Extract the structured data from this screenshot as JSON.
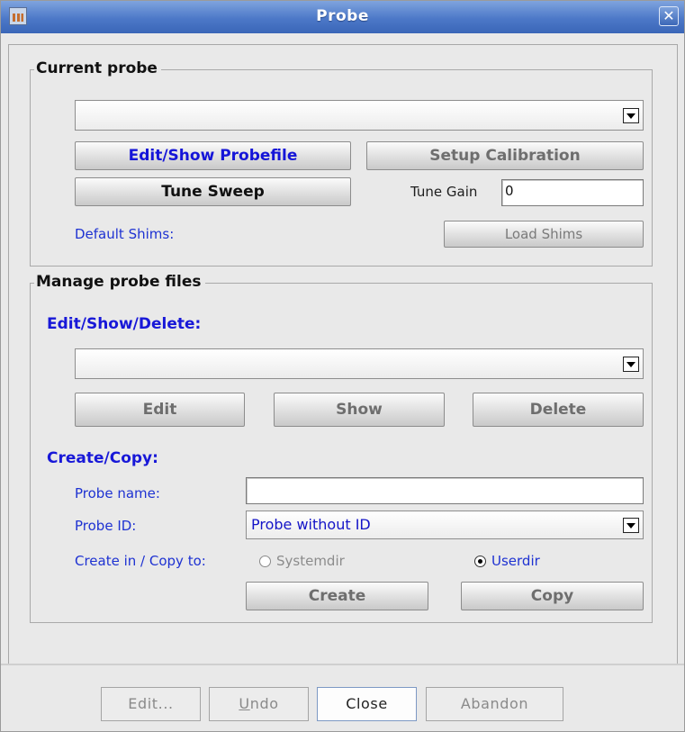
{
  "window": {
    "title": "Probe"
  },
  "current_probe": {
    "group_label": "Current probe",
    "probe_select_value": "",
    "edit_show_probefile": "Edit/Show Probefile",
    "setup_calibration": "Setup Calibration",
    "tune_sweep": "Tune Sweep",
    "tune_gain_label": "Tune Gain",
    "tune_gain_value": "0",
    "default_shims_label": "Default Shims:",
    "load_shims": "Load Shims"
  },
  "manage": {
    "group_label": "Manage probe files",
    "eds_heading": "Edit/Show/Delete:",
    "file_select_value": "",
    "edit": "Edit",
    "show": "Show",
    "delete": "Delete",
    "create_copy_heading": "Create/Copy:",
    "probe_name_label": "Probe name:",
    "probe_name_value": "",
    "probe_id_label": "Probe ID:",
    "probe_id_value": "Probe without ID",
    "create_in_label": "Create in / Copy to:",
    "radio_systemdir": "Systemdir",
    "radio_userdir": "Userdir",
    "selected_dir": "Userdir",
    "create": "Create",
    "copy": "Copy"
  },
  "footer": {
    "edit": "Edit...",
    "undo": "Undo",
    "close": "Close",
    "abandon": "Abandon"
  },
  "icons": [
    "app-icon",
    "close-icon",
    "chevron-down-icon"
  ]
}
